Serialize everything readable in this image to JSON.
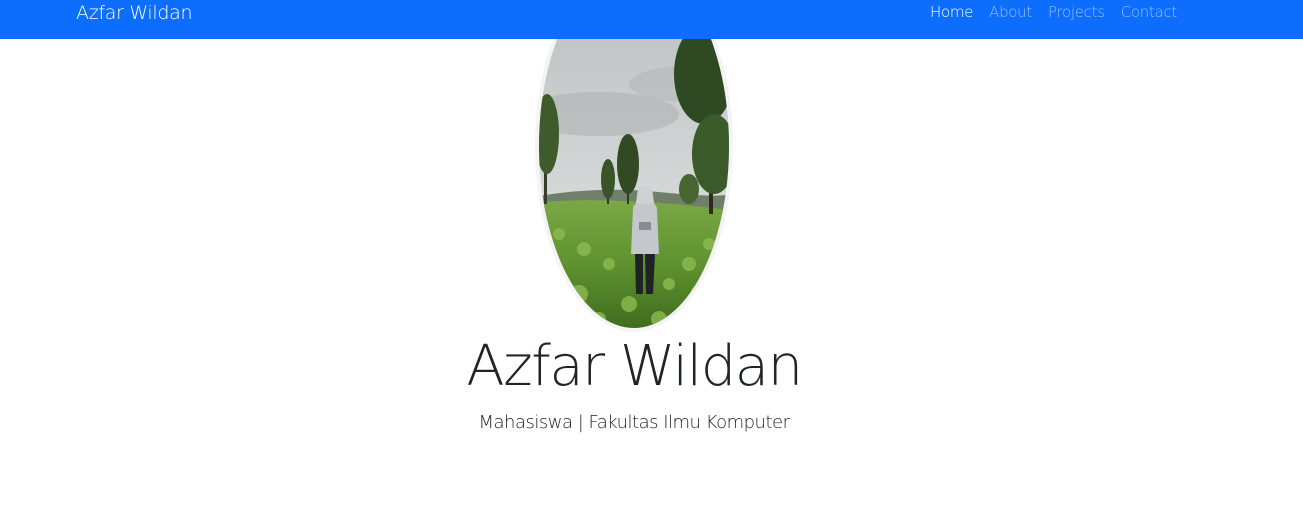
{
  "navbar": {
    "brand": "Azfar Wildan",
    "links": [
      {
        "label": "Home",
        "active": true
      },
      {
        "label": "About",
        "active": false
      },
      {
        "label": "Projects",
        "active": false
      },
      {
        "label": "Contact",
        "active": false
      }
    ]
  },
  "hero": {
    "name": "Azfar Wildan",
    "subtitle": "Mahasiswa | Fakultas Ilmu Komputer",
    "avatar": "profile-photo-tea-plantation"
  },
  "colors": {
    "navbar_bg": "#0d6efd",
    "nav_link_active": "#ffffff",
    "nav_link_inactive": "rgba(255,255,255,0.55)",
    "text": "#212529",
    "background": "#ffffff"
  }
}
